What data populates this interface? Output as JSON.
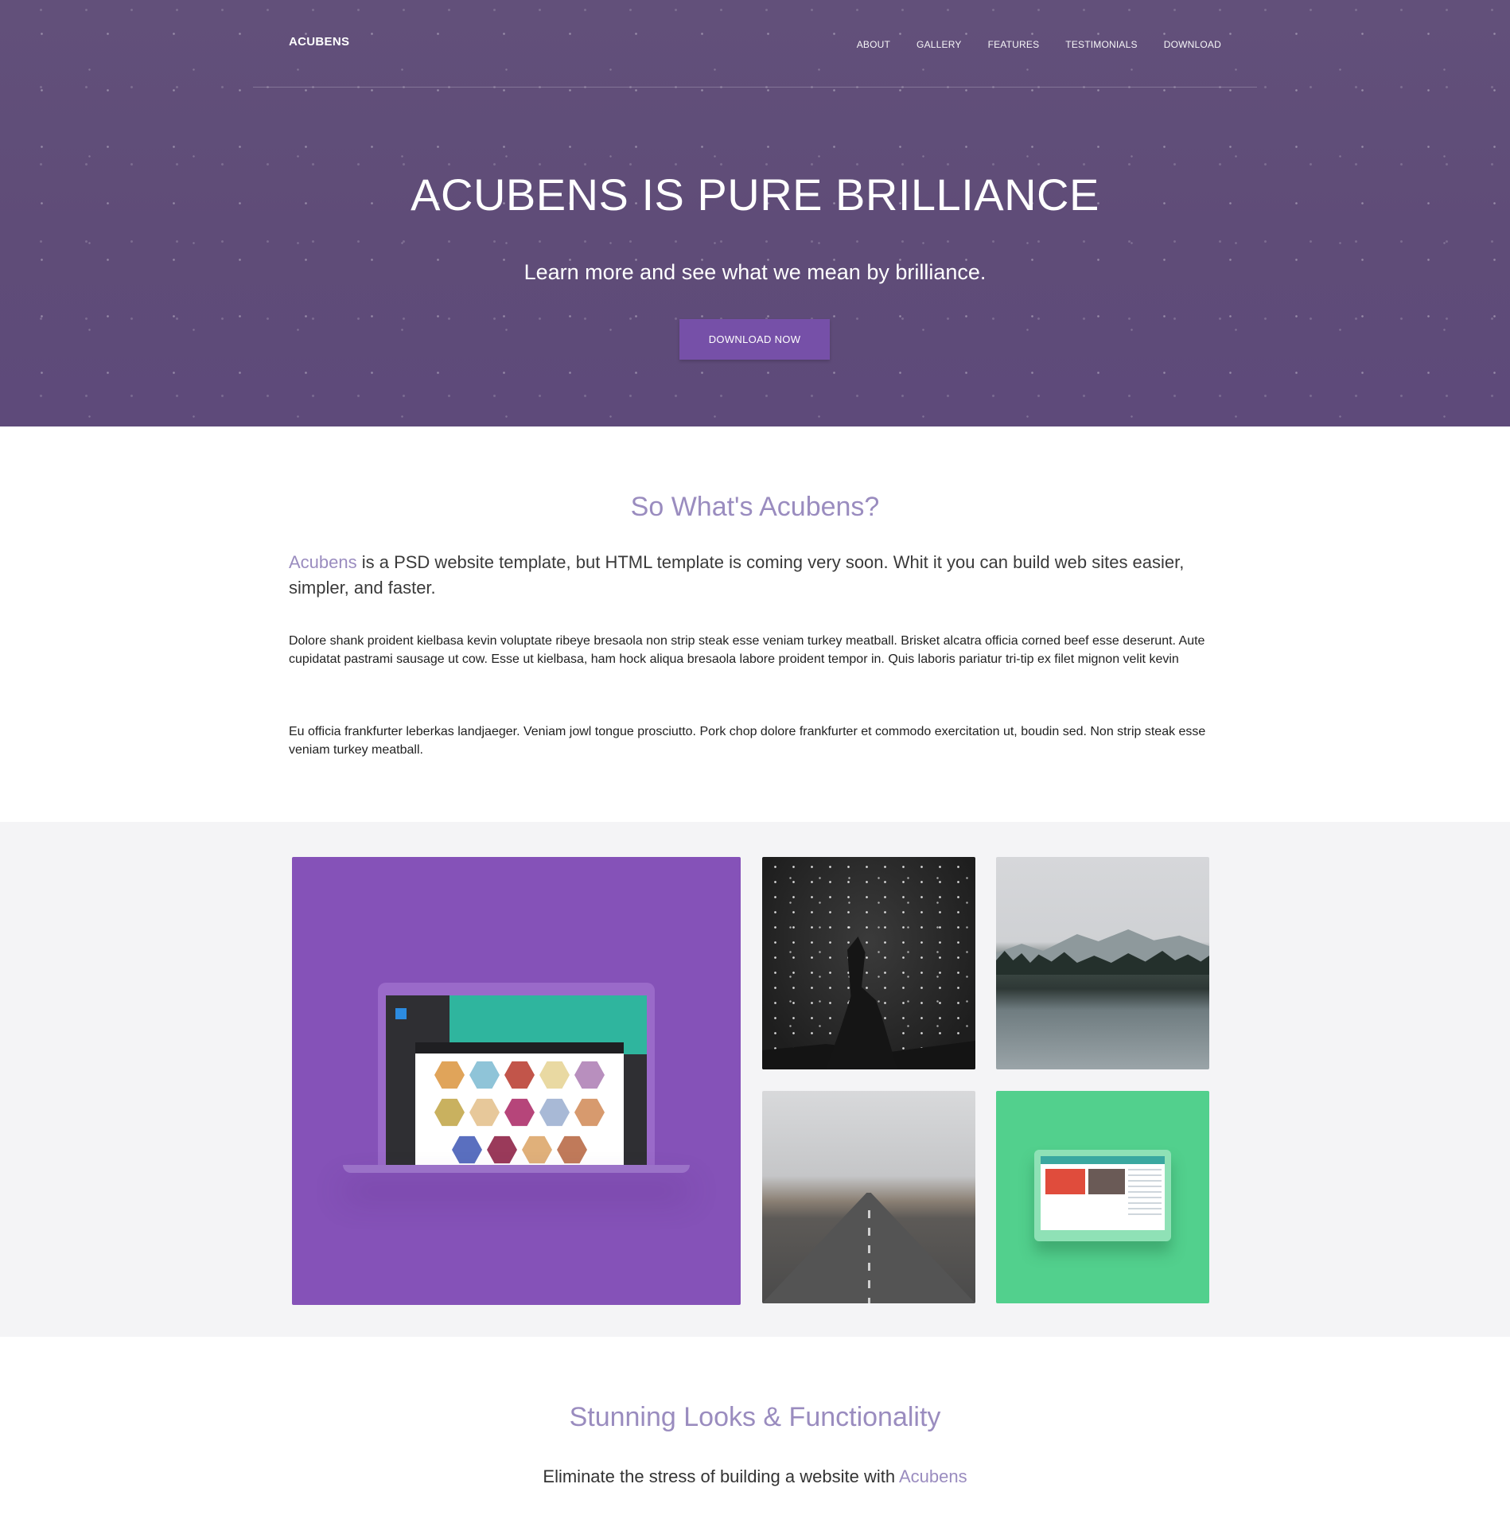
{
  "nav": {
    "logo": "ACUBENS",
    "links": [
      "ABOUT",
      "GALLERY",
      "FEATURES",
      "TESTIMONIALS",
      "DOWNLOAD"
    ]
  },
  "hero": {
    "title": "ACUBENS IS PURE BRILLIANCE",
    "subtitle": "Learn more and see what we mean by brilliance.",
    "cta": "DOWNLOAD NOW"
  },
  "about": {
    "title": "So What's Acubens?",
    "lead_brand": "Acubens",
    "lead_rest": " is a PSD website template, but HTML template is coming very soon. Whit it you can build web sites easier, simpler, and faster.",
    "p1": "Dolore shank proident kielbasa kevin voluptate ribeye bresaola non strip steak esse veniam turkey meatball. Brisket alcatra officia corned beef esse deserunt. Aute cupidatat pastrami sausage ut cow. Esse ut kielbasa, ham hock aliqua bresaola labore proident tempor in. Quis laboris pariatur tri-tip ex filet mignon velit kevin",
    "p2": "Eu officia frankfurter leberkas landjaeger. Veniam jowl tongue prosciutto. Pork chop dolore frankfurter et commodo exercitation ut, boudin sed. Non strip steak esse veniam turkey meatball."
  },
  "features": {
    "title": "Stunning Looks & Functionality",
    "sub_prefix": "Eliminate the stress of building a website with ",
    "sub_brand": "Acubens"
  },
  "colors": {
    "hero_bg": "#5f4c78",
    "accent": "#9a8cbf",
    "button": "#7650a8",
    "tile_purple": "#8552b8",
    "tile_green": "#52d08d"
  }
}
